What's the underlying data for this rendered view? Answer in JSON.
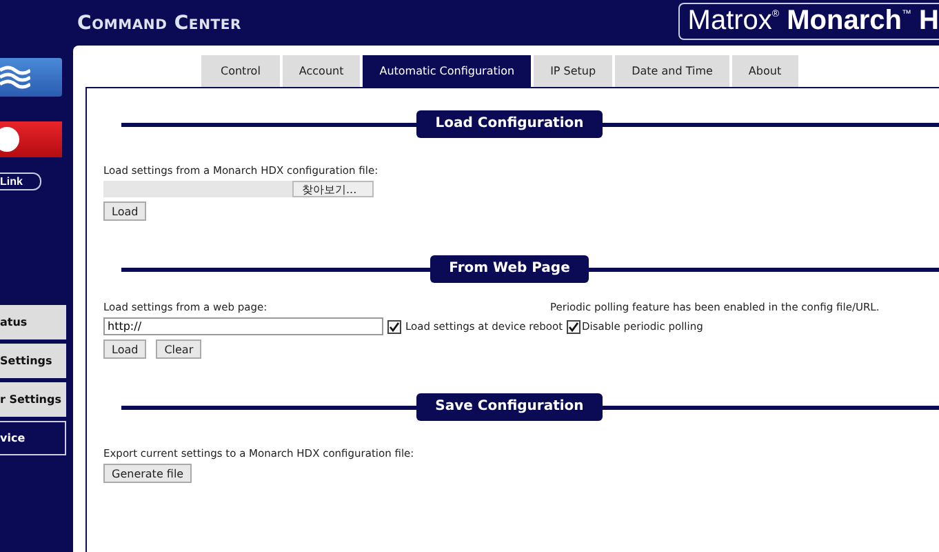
{
  "header": {
    "title": "Command Center",
    "logo": "Matrox$^{®}$ **Monarch**$^{™}$ **H**"
  },
  "sidebar": {
    "items": [
      {
        "kind": "waves"
      },
      {
        "kind": "record"
      },
      {
        "kind": "link",
        "label": "Link"
      }
    ],
    "menu": [
      {
        "label": "atus",
        "selected": false
      },
      {
        "label": "Settings",
        "selected": false
      },
      {
        "label": "r Settings",
        "selected": false
      },
      {
        "label": "vice",
        "selected": true
      }
    ]
  },
  "tabs": [
    {
      "label": "Control",
      "selected": false
    },
    {
      "label": "Account",
      "selected": false
    },
    {
      "label": "Automatic Configuration",
      "selected": true
    },
    {
      "label": "IP Setup",
      "selected": false
    },
    {
      "label": "Date and Time",
      "selected": false
    },
    {
      "label": "About",
      "selected": false
    }
  ],
  "sections": [
    {
      "title": "Load Configuration",
      "kind": "file",
      "label": "Load settings from a Monarch HDX configuration file:",
      "browse": "찾아보기...",
      "buttons": [
        "Load"
      ]
    },
    {
      "title": "From Web Page",
      "kind": "url",
      "label": "Load settings from a web page:",
      "value": "http://",
      "reboot": {
        "label": "Load settings at device reboot",
        "checked": true
      },
      "note": "Periodic polling feature has been enabled in the config file/URL.",
      "polling": {
        "label": "Disable periodic polling",
        "checked": true
      },
      "buttons": [
        "Load",
        "Clear"
      ]
    },
    {
      "title": "Save Configuration",
      "kind": "export",
      "label": "Export current settings to a Monarch HDX configuration file:",
      "buttons": [
        "Generate file"
      ]
    }
  ]
}
